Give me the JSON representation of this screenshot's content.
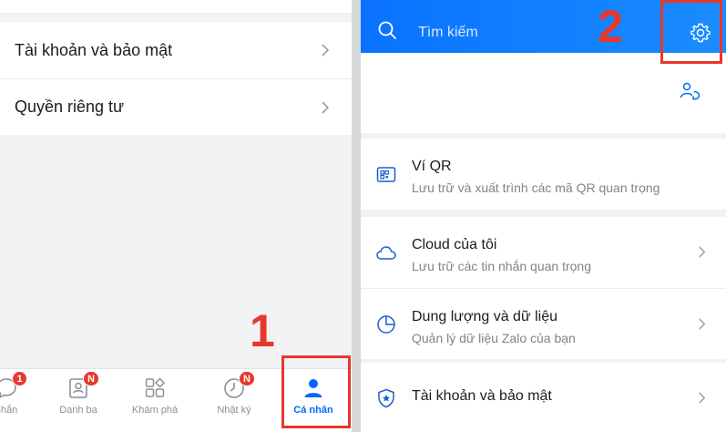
{
  "left": {
    "rows": [
      {
        "label": "Tài khoản và bảo mật"
      },
      {
        "label": "Quyền riêng tư"
      }
    ],
    "bottom_nav": [
      {
        "label": "nhắn",
        "badge": "1",
        "icon": "chat-icon"
      },
      {
        "label": "Danh bạ",
        "badge": "N",
        "icon": "contacts-icon"
      },
      {
        "label": "Khám phá",
        "badge": "",
        "icon": "discover-icon"
      },
      {
        "label": "Nhật ký",
        "badge": "N",
        "icon": "clock-icon"
      },
      {
        "label": "Cá nhân",
        "badge": "",
        "icon": "person-icon",
        "active": true
      }
    ],
    "step_label": "1"
  },
  "right": {
    "search_placeholder": "Tìm kiếm",
    "step_label": "2",
    "items": [
      {
        "title": "Ví QR",
        "subtitle": "Lưu trữ và xuất trình các mã QR quan trọng",
        "icon": "qr-wallet-icon"
      },
      {
        "title": "Cloud của tôi",
        "subtitle": "Lưu trữ các tin nhắn quan trọng",
        "icon": "cloud-icon"
      },
      {
        "title": "Dung lượng và dữ liệu",
        "subtitle": "Quản lý dữ liệu Zalo của bạn",
        "icon": "pie-chart-icon"
      },
      {
        "title": "Tài khoản và bảo mật",
        "subtitle": "",
        "icon": "shield-icon"
      }
    ]
  },
  "colors": {
    "brand_blue": "#0068ff",
    "annotation_red": "#e8372c"
  }
}
